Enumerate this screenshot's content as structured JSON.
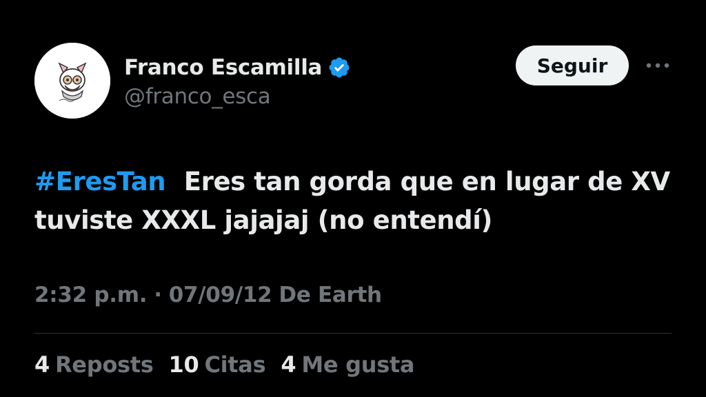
{
  "author": {
    "display_name": "Franco Escamilla",
    "handle": "@franco_esca",
    "verified": true,
    "avatar_icon": "cartoon-mascot-avatar"
  },
  "follow_button": {
    "label": "Seguir"
  },
  "more_menu": {
    "icon": "more-horizontal-icon"
  },
  "tweet": {
    "hashtag": "#EresTan",
    "text": "Eres tan gorda que en lugar de XV tuviste XXXL  jajajaj (no entendí)"
  },
  "meta": {
    "time": "2:32 p.m.",
    "separator": "·",
    "date": "07/09/12",
    "source": "De Earth"
  },
  "stats": [
    {
      "count": "4",
      "label": "Reposts"
    },
    {
      "count": "10",
      "label": "Citas"
    },
    {
      "count": "4",
      "label": "Me gusta"
    }
  ],
  "colors": {
    "background": "#000000",
    "primary_text": "#e7e9ea",
    "secondary_text": "#71767b",
    "accent": "#1d9bf0",
    "button_bg": "#eff3f4",
    "divider": "#2f3336"
  }
}
